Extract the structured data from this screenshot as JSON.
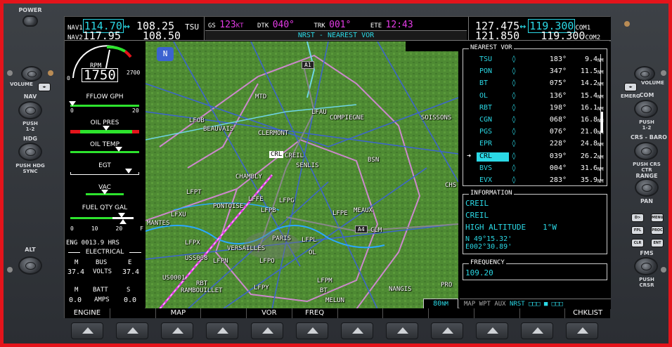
{
  "bezel": {
    "power_label": "POWER",
    "left_labels": {
      "volume": "VOLUME",
      "nav": "NAV",
      "hdg": "HDG",
      "push_hdg": "PUSH HDG SYNC",
      "alt": "ALT",
      "push12": "PUSH 1-2"
    },
    "right_labels": {
      "volume": "VOLUME",
      "com": "COM",
      "emerg": "EMERG",
      "push12": "PUSH 1-2",
      "crs_baro": "CRS - BARO",
      "push_crs": "PUSH CRS CTR",
      "range": "RANGE",
      "pan": "PAN",
      "fms": "FMS",
      "push_crsr": "PUSH CRSR",
      "dir": "D>",
      "menu": "MENU",
      "fpl": "FPL",
      "proc": "PROC",
      "clr": "CLR",
      "ent": "ENT"
    }
  },
  "top": {
    "nav1_label": "NAV1",
    "nav1_active": "114.70",
    "nav1_standby": "108.25",
    "nav2_label": "NAV2",
    "nav2_active": "117.95",
    "nav2_standby": "108.50",
    "tsu": "TSU",
    "gs_label": "GS",
    "gs_value": "123",
    "gs_unit": "KT",
    "dtk_label": "DTK",
    "dtk_value": "040°",
    "trk_label": "TRK",
    "trk_value": "001°",
    "ete_label": "ETE",
    "ete_value": "12:43",
    "page_title": "NRST - NEAREST VOR",
    "com1_active": "127.475",
    "com1_standby": "119.300",
    "com1_label": "COM1",
    "com2_active": "121.850",
    "com2_standby": "119.300",
    "com2_label": "COM2",
    "swap": "↔"
  },
  "eis": {
    "rpm_label": "RPM",
    "rpm_value": "1750",
    "rpm_min": "0",
    "rpm_max": "2700",
    "fflow_label": "FFLOW GPH",
    "fflow_min": "0",
    "fflow_max": "20",
    "oil_pres": "OIL PRES",
    "oil_temp": "OIL TEMP",
    "egt": "EGT",
    "vac": "VAC",
    "fuel_label": "FUEL QTY GAL",
    "fuel_ticks": [
      "0",
      "10",
      "20",
      "F"
    ],
    "fuel_L": "L",
    "fuel_R": "R",
    "eng_hrs": "ENG 0013.9 HRS",
    "electrical": "ELECTRICAL",
    "m": "M",
    "bus": "BUS",
    "e": "E",
    "volts_m": "37.4",
    "volts_label": "VOLTS",
    "volts_e": "37.4",
    "batt_m": "M",
    "batt": "BATT",
    "batt_s": "S",
    "amps_m": "0.0",
    "amps_label": "AMPS",
    "amps_s": "0.0"
  },
  "nearest_vor": {
    "title": "NEAREST VOR",
    "rows": [
      {
        "id": "TSU",
        "brg": "183°",
        "dist": "9.4"
      },
      {
        "id": "PON",
        "brg": "347°",
        "dist": "11.5"
      },
      {
        "id": "BT",
        "brg": "075°",
        "dist": "14.2"
      },
      {
        "id": "OL",
        "brg": "136°",
        "dist": "15.4"
      },
      {
        "id": "RBT",
        "brg": "198°",
        "dist": "16.1"
      },
      {
        "id": "CGN",
        "brg": "068°",
        "dist": "16.8"
      },
      {
        "id": "PGS",
        "brg": "076°",
        "dist": "21.0"
      },
      {
        "id": "EPR",
        "brg": "228°",
        "dist": "24.8"
      },
      {
        "id": "CRL",
        "brg": "039°",
        "dist": "26.2"
      },
      {
        "id": "BVS",
        "brg": "004°",
        "dist": "31.6"
      },
      {
        "id": "EVX",
        "brg": "283°",
        "dist": "35.9"
      }
    ],
    "unit": "NM",
    "selected_index": 8
  },
  "information": {
    "title": "INFORMATION",
    "line1": "CREIL",
    "line2": "CREIL",
    "line3": "HIGH ALTITUDE",
    "variation": "1°W",
    "lat": "N 49°15.32'",
    "lon": "E002°30.89'"
  },
  "frequency": {
    "title": "FREQUENCY",
    "value": "109.20"
  },
  "map": {
    "range": "80",
    "range_unit": "NM",
    "north": "N",
    "road_a1": "A1",
    "road_a4": "A4",
    "labels": [
      "MTD",
      "LFOB",
      "BEAUVAIS",
      "CLERMONT",
      "LFAU",
      "COMPIEGNE",
      "SOISSONS",
      "CRL",
      "CREIL",
      "SENLIS",
      "BSN",
      "CHAMBLY",
      "LFPT",
      "PONTOISE",
      "LFFE",
      "LFPG",
      "LFPB",
      "LFXU",
      "MANTES",
      "LFPE",
      "MEAUX",
      "CLM",
      "LFPX",
      "PARIS",
      "LFPL",
      "VERSAILLES",
      "USS008",
      "LFPN",
      "LFPO",
      "US0001",
      "RBT",
      "RAMBOUILLET",
      "LFPY",
      "LFPM",
      "NANGIS",
      "PRO",
      "MELUN",
      "CHS",
      "BT",
      "OL"
    ]
  },
  "statusbar": {
    "text": "MAP WPT AUX",
    "active": "NRST",
    "boxes": "□□□ ■ □□□"
  },
  "softkeys": [
    "ENGINE",
    "",
    "MAP",
    "",
    "VOR",
    "FREQ",
    "",
    "",
    "",
    "",
    "",
    "CHKLIST"
  ]
}
